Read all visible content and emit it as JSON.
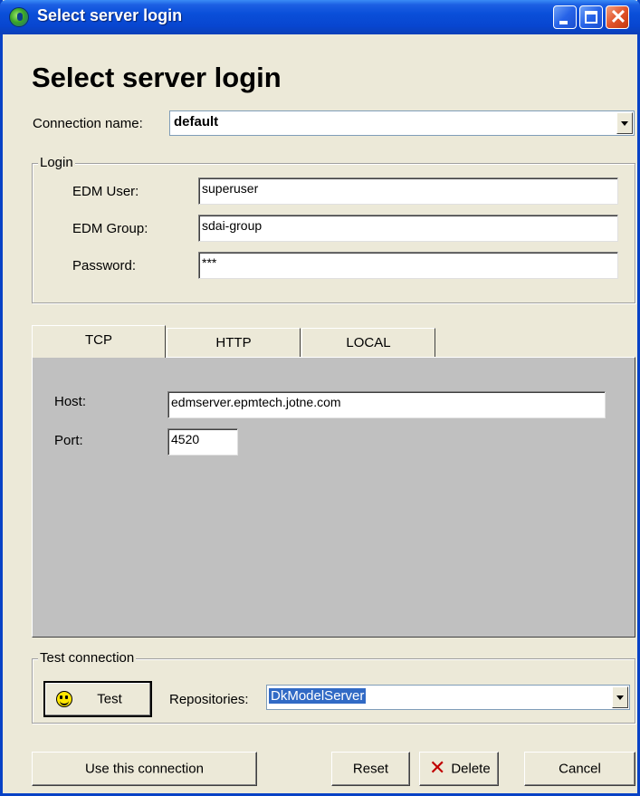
{
  "window": {
    "title": "Select server login",
    "heading": "Select server login"
  },
  "connection": {
    "label": "Connection name:",
    "value": "default"
  },
  "login": {
    "group_label": "Login",
    "fields": [
      {
        "label": "EDM User:",
        "value": "superuser"
      },
      {
        "label": "EDM Group:",
        "value": "sdai-group"
      },
      {
        "label": "Password:",
        "value": "***"
      }
    ]
  },
  "tabs": [
    {
      "label": "TCP",
      "active": true
    },
    {
      "label": "HTTP",
      "active": false
    },
    {
      "label": "LOCAL",
      "active": false
    }
  ],
  "tcp": {
    "host_label": "Host:",
    "host_value": "edmserver.epmtech.jotne.com",
    "port_label": "Port:",
    "port_value": "4520"
  },
  "test_connection": {
    "group_label": "Test connection",
    "test_button": "Test",
    "repositories_label": "Repositories:",
    "repositories_value": "DkModelServer"
  },
  "footer": {
    "use_button": "Use this connection",
    "reset_button": "Reset",
    "delete_button": "Delete",
    "cancel_button": "Cancel"
  },
  "colors": {
    "titlebar": "#0a4fd9",
    "dialog_bg": "#ece9d8",
    "tab_panel_bg": "#c0c0c0",
    "selection_bg": "#316ac5"
  },
  "icons": {
    "app": "globe-icon",
    "test": "smiley-icon",
    "delete": "x-icon"
  }
}
